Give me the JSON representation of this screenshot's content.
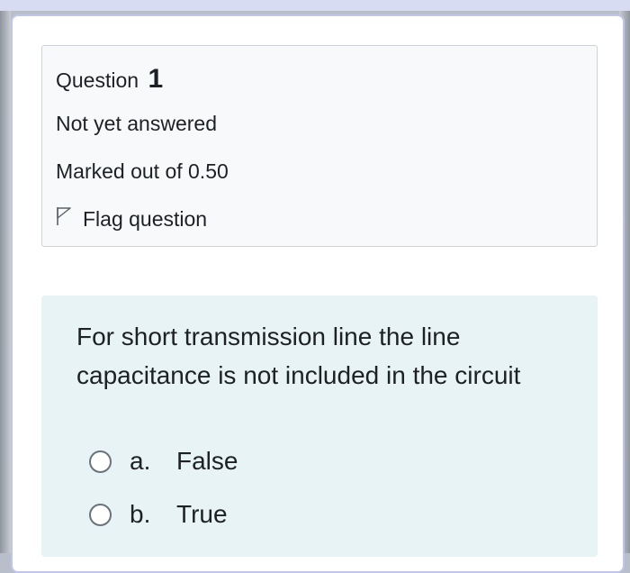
{
  "question": {
    "label": "Question",
    "number": "1",
    "state": "Not yet answered",
    "grade": "Marked out of 0.50",
    "flag_label": "Flag question",
    "text": "For short transmission line the line capacitance is not included in the circuit",
    "answers": [
      {
        "letter": "a.",
        "label": "False"
      },
      {
        "letter": "b.",
        "label": "True"
      }
    ]
  },
  "icons": {
    "flag": "flag-outline-icon"
  },
  "colors": {
    "info_bg": "#f8f9fa",
    "content_bg": "#e7f3f5",
    "text": "#1d2125"
  }
}
